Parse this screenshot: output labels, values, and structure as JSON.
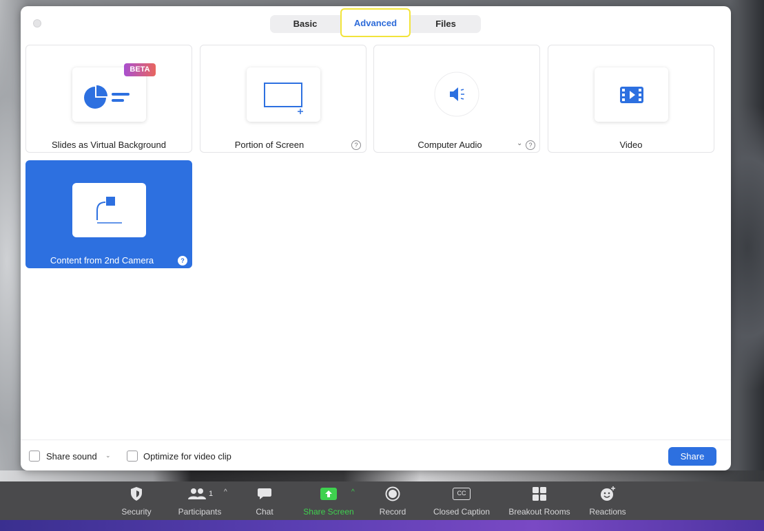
{
  "tabs": [
    {
      "label": "Basic"
    },
    {
      "label": "Advanced"
    },
    {
      "label": "Files"
    }
  ],
  "cards": [
    {
      "label": "Slides as Virtual Background",
      "badge": "BETA"
    },
    {
      "label": "Portion of Screen",
      "help": "?"
    },
    {
      "label": "Computer Audio",
      "help": "?",
      "dropdown": "⌄"
    },
    {
      "label": "Video"
    },
    {
      "label": "Content from 2nd Camera",
      "help": "?"
    }
  ],
  "footer": {
    "share_sound": "Share sound",
    "share_sound_chevron": "⌄",
    "optimize": "Optimize for video clip",
    "share_button": "Share"
  },
  "toolbar": {
    "security": "Security",
    "participants": "Participants",
    "participants_count": "1",
    "chat": "Chat",
    "share_screen": "Share Screen",
    "record": "Record",
    "closed_caption": "Closed Caption",
    "cc_glyph": "CC",
    "breakout_rooms": "Breakout Rooms",
    "reactions": "Reactions",
    "caret": "^"
  },
  "colors": {
    "accent": "#2d70e0",
    "highlight": "#f2e43a",
    "share_green": "#3fd14f"
  }
}
